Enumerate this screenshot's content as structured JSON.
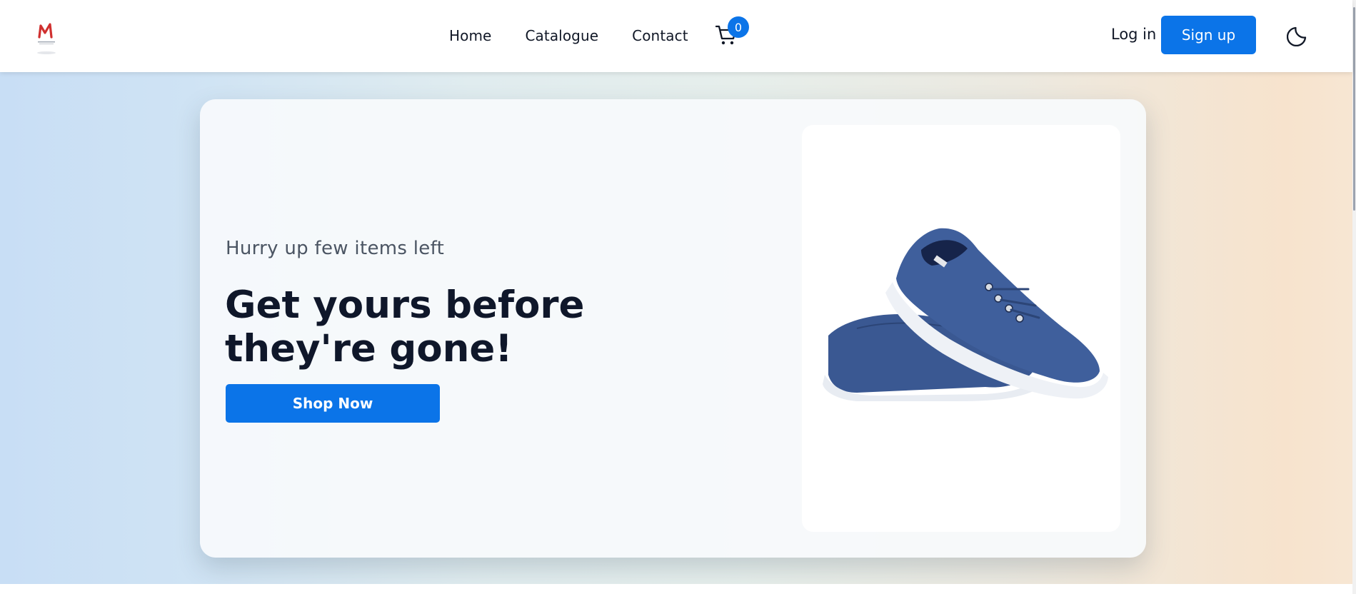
{
  "nav": {
    "links": [
      "Home",
      "Catalogue",
      "Contact"
    ],
    "cart_count": "0",
    "login_label": "Log in",
    "signup_label": "Sign up"
  },
  "hero": {
    "subtitle": "Hurry up few items left",
    "headline": "Get yours before they're gone!",
    "cta_label": "Shop Now"
  },
  "icons": {
    "logo": "brand-logo",
    "cart": "shopping-cart-icon",
    "theme": "moon-icon",
    "product": "blue-canvas-sneakers"
  },
  "colors": {
    "accent": "#0b74e8",
    "text_dark": "#0f172a",
    "logo_red": "#d0302f",
    "shoe_blue": "#3a5892"
  }
}
